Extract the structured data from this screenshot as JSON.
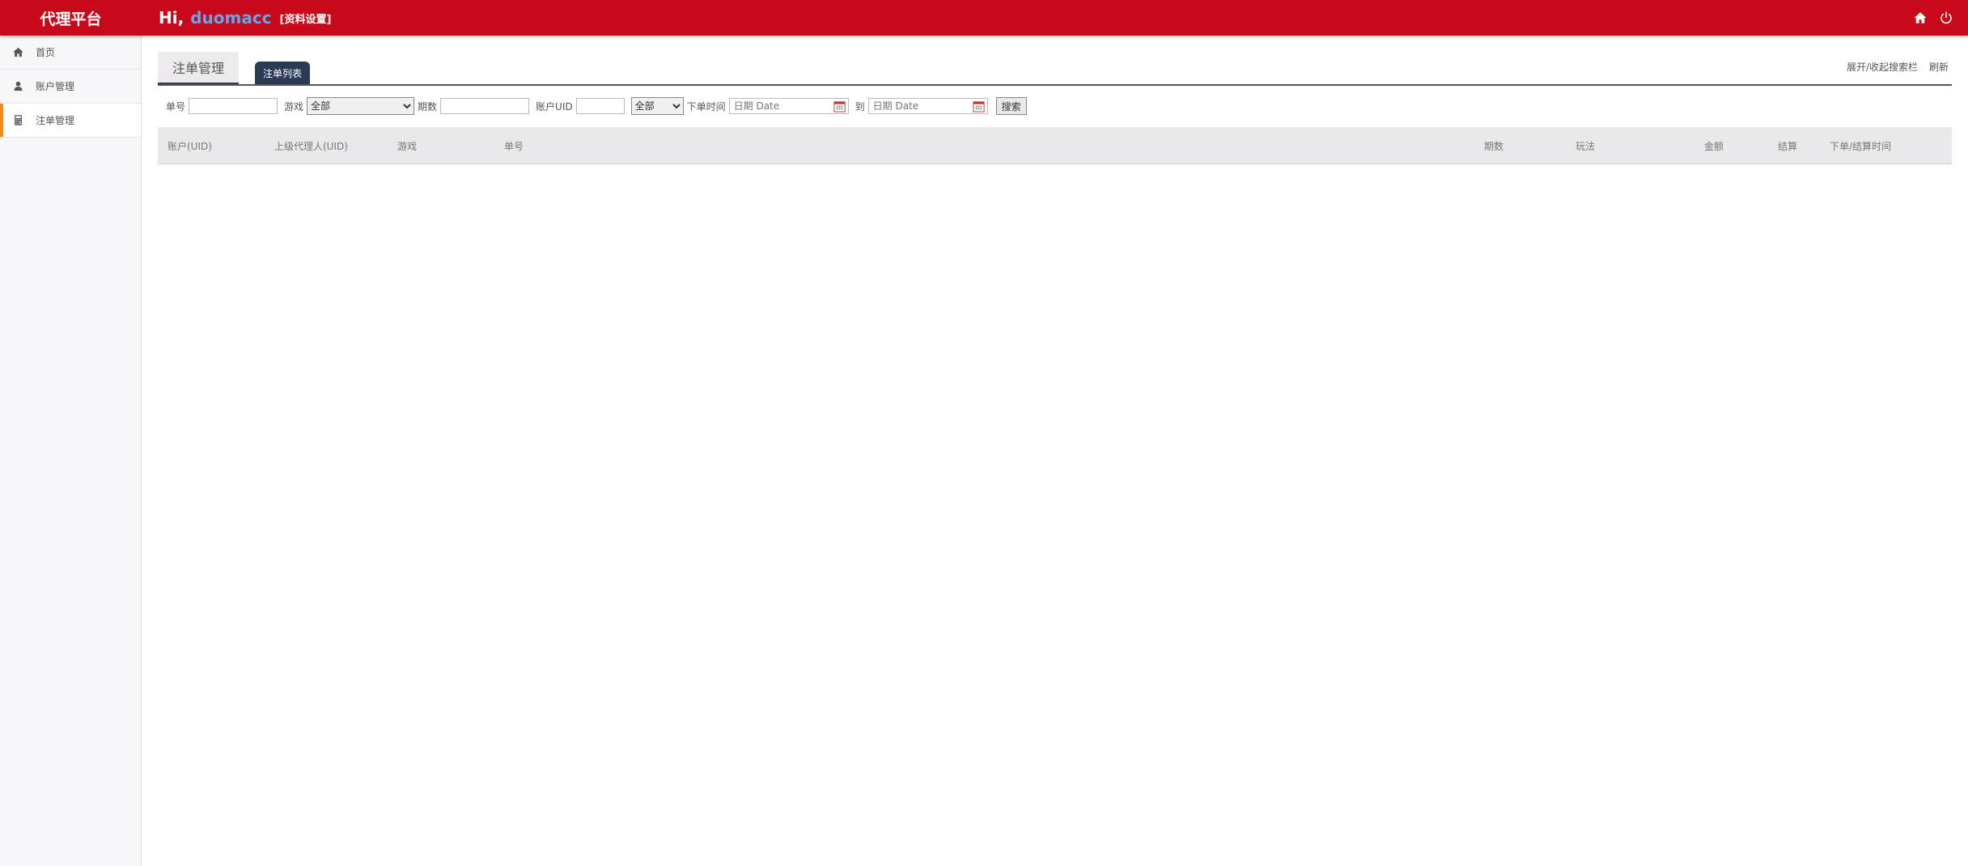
{
  "header": {
    "brand": "代理平台",
    "greeting": "Hi,",
    "username": "duomacc",
    "profile_link": "[资料设置]"
  },
  "sidebar": {
    "items": [
      {
        "label": "首页",
        "icon": "home-icon"
      },
      {
        "label": "账户管理",
        "icon": "user-icon"
      },
      {
        "label": "注单管理",
        "icon": "calculator-icon",
        "active": true
      }
    ]
  },
  "tabs": {
    "title": "注单管理",
    "active_tab": "注单列表",
    "toggle_search": "展开/收起搜索栏",
    "refresh": "刷新"
  },
  "filters": {
    "order_no_label": "单号",
    "game_label": "游戏",
    "game_selected": "全部",
    "period_label": "期数",
    "uid_label": "账户UID",
    "status_selected": "全部",
    "time_label": "下单时间",
    "date_placeholder": "日期 Date",
    "to_label": "到",
    "search_button": "搜索"
  },
  "table": {
    "columns": [
      "账户(UID)",
      "上级代理人(UID)",
      "游戏",
      "单号",
      "期数",
      "玩法",
      "金额",
      "结算",
      "下单/结算时间"
    ],
    "rows": []
  },
  "colors": {
    "topbar": "#c8091b",
    "username": "#5fa8ee",
    "active_accent": "#f38b1c",
    "tab_dark": "#2b3a55"
  }
}
